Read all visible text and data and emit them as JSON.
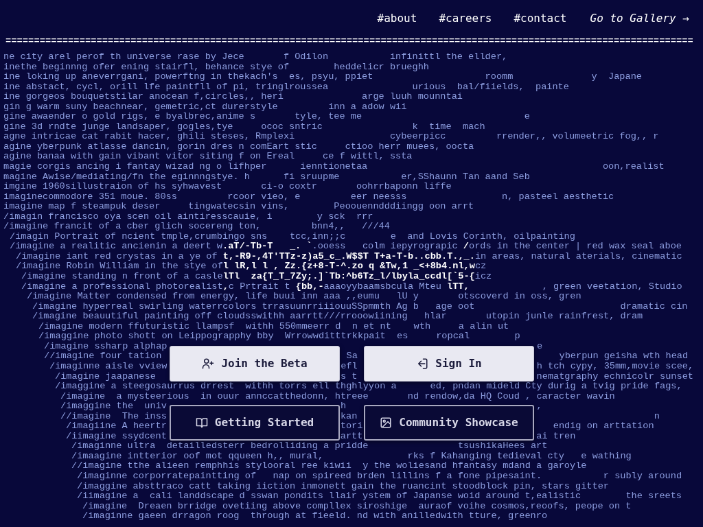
{
  "nav": {
    "links": [
      "#about",
      "#careers",
      "#contact"
    ],
    "gallery_link": "Go to Gallery →"
  },
  "divider": "=========================================================================================================================",
  "prompt_lines": [
    "ne city arel perof th universe rase by Jece       f Odilon           infinittl the ellder,",
    "inethe beginnng ofer ening stairfl, behance stye of        heddelicr brueghh",
    "ine loking up aneverrgani, powerftng in thekach's  es, psyu, ppiet                    roomm              y  Japane",
    "ine abstact, cycl, orill lfe paintfll of pi, tringlroussea               urious  bal/fiields,  painte",
    "ine gorgeos bouquetstilar anocean f,circles,, heri              arge luuh mounntai",
    "gin g warm suny beachnear, gemetric,ct durerstyle         inn a adow wii",
    "gine awaender o gold rigs, e byalbrec,anime s       tyle, tee me                             e",
    "gine 3d rndte junge landsaper, gogles,tye     ococ sntric                k  time  mach",
    "agne intricae cat rabit hacer, ghili steses, Rmplexi                 cybeerpicc         rrender,, volumeetric fog,, r",
    "agine yberpunk atlasse dancin, gorin dres n comEart stic     ctioo herr muees, oocta",
    "agine banaa with gain vibant vitor siting f on Ereal     ce f wittl, ssta",
    "magie corgis ancing i fantay wizad ng o lifhper      ienntionetaa                                          oon,realist",
    "magine Awise/mediating/fn the eginnngstye. h      fi sruupme           er,SShaunn Tan aand Seb",
    "imgine 1960sillustraion of hs syhwavest       ci-o coxtr       oohrrbaponn liffe",
    "imaginecommodore 351 moue. 80ss         rcoor vieo, e         eer neesss                 n, pasteel aesthetic",
    "imagine map f steampuk deser     tingwatecsin vins,        Peoouenndddiingg oon arrt",
    "/imagin francisco oya scen oil aintiresscauie, i        y sck  rrr",
    "/imagine francit of a cber glich socereng ton,         bnn4,,   ///44",
    "/imagin Portrait of ncient tmple,crumbingo sns    tcc,inn;;c        e  and Lovis Corinth, oilpainting",
    "/imagine a realitic ancienin a deert w**.aT/-Tb-T   _. `**.ooess   colm iepyrograpic **/**ords in the center | red wax seal aboe",
    "/imagine iant red crystas in a ye of **t,-R9-,4T'TTz-z)a5_c_.W$$T T+a-T-b..cbb.T.,_.**in areas, natural aterials, cinematic",
    "/imagine Robin William in the stye of**l lR,l l , Zz.{z+8-T-^.zo q &Tw,1 _<+8b4.nl,w**cz",
    "/imagine standing n front of a casle**lTl  za{T_T_7Zy;.]`Tb:^b6Tz_l/lbyla_ccdl[`5-{**icz",
    "/imagine a professional photorealist**,**c Prtrait t **{bb,-**aaaoyybaamsbcula Mteu **lTT,**             , green veetation, Studio",
    "/imagine Matter condensed from energy, life buui inn aaa ,,eumu   lU y       otscoverd in oss, gren",
    "/imagine hyperreal swirling waterrcolors trrasuunrriiiouuSSpmmth Ag b   age oot                          dramatic cin",
    "/imagine beauutiful painting off cloudsswithh aarrtt///rrooowiining   hlar       utopin junle rainfrest, dram",
    "/imagine modern ffuturistic llampsf  withh 550mmeerr d  n et nt    wth     a alin ut",
    "/imaggine photo shott on Leippograpphy bby  Wrrowwditttrkkpait  es     ropcal        p",
    "/imagine ssharp alphap                                                                  e",
    "//imagine four tation                                 Sa                                    yberpun geisha wth head",
    "/imaginne aisle vview                               efl                                h tch cypy, 35mm,movie scee,",
    "/imagine jaapanese                                 s t                                nematgraphy echnicolr sunset",
    "/imaggine a steegosaurrus drrest  withh torrs ell thghlyyon a      ed, pndan mideld Cty durig a tvig pride fags,",
    "/imagine  a mysteerious  in ouur annccatthedonn, htreee       nd rendow,da HQ Coud , caracter wavin",
    "/imaggine the  univ                               h                                  ,",
    "//imagine  The inss                               kan                                                     n",
    "/imagiine A heertr                               tori                                  endig on arttation",
    "/iimagine ssydcent                               artt                               ai tren",
    "/imaginne ultra  detailledsterr bedrolliding a pridde                tsushikaHees art",
    "/imaagine intterior oof mot qqueen h,, mural,               rks f Kahanging tedieval cty   e wathing",
    "//imagine tthe alieen remphhis stylooral ree kiwii  y the woliesand hfantasy mdand a garoyle",
    "/imaginne corporratepaintting of   nap on spireed brden lillins f a fone pipesaint.           r subly around",
    "/imaggine absttraco catt taking iiction inmonett gain the ruancint stoodblock pin, stars gitter",
    "/iimagine a  cali landdscape d sswan pondits llair ystem of Japanse woid around t,ealistic        the sreets",
    "/imagine  Dreaen brridge ovetiing above compllex siroshige  auraof voihe cosmos,reoofs, peope on t",
    "/imaginne gaeen drragon roog  through at fieeld. nd with anilledwith tture, greenro"
  ],
  "buttons": [
    {
      "label": "Join the Beta",
      "kind": "light"
    },
    {
      "label": "Sign In",
      "kind": "light"
    },
    {
      "label": "Getting Started",
      "kind": "outline"
    },
    {
      "label": "Community Showcase",
      "kind": "outline"
    }
  ]
}
